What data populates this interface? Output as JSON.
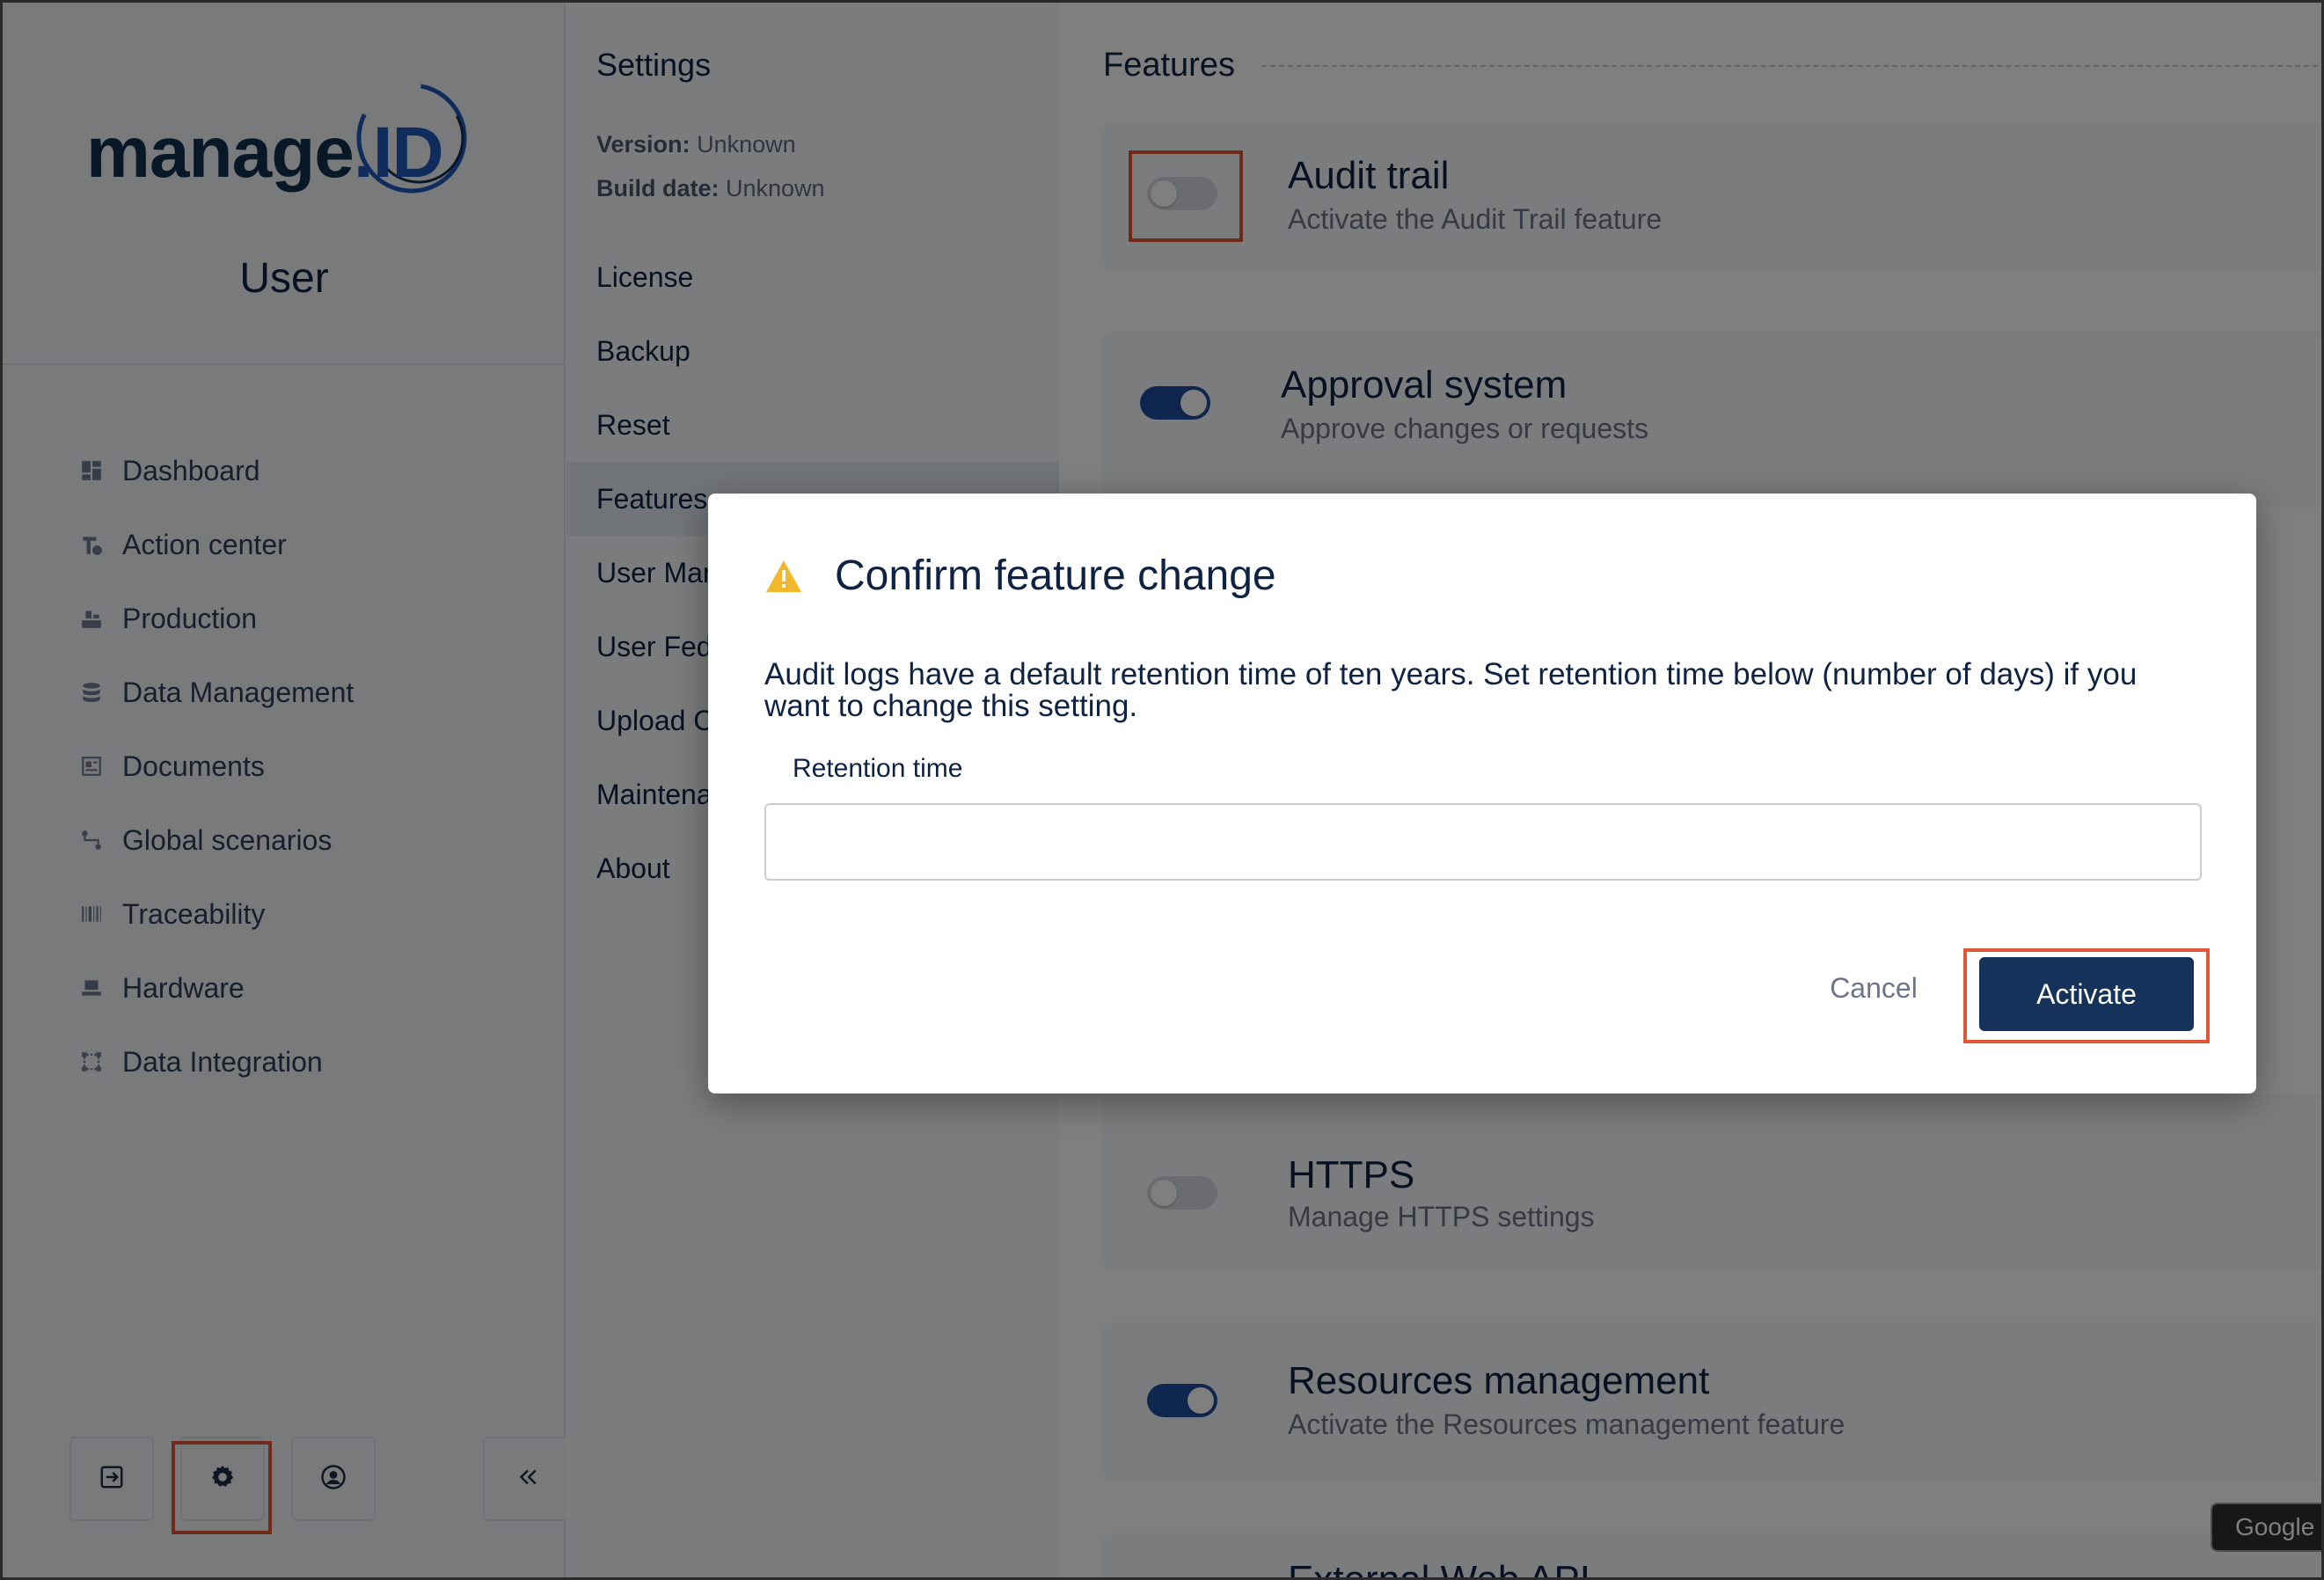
{
  "brand": {
    "logo_main": "manage",
    "logo_dot": ".",
    "logo_id": "ID"
  },
  "sidebar": {
    "user_title": "User",
    "nav": [
      {
        "label": "Dashboard",
        "icon": "dashboard-icon"
      },
      {
        "label": "Action center",
        "icon": "action-center-icon"
      },
      {
        "label": "Production",
        "icon": "production-icon"
      },
      {
        "label": "Data Management",
        "icon": "database-icon"
      },
      {
        "label": "Documents",
        "icon": "documents-icon"
      },
      {
        "label": "Global scenarios",
        "icon": "scenarios-icon"
      },
      {
        "label": "Traceability",
        "icon": "barcode-icon"
      },
      {
        "label": "Hardware",
        "icon": "hardware-icon"
      },
      {
        "label": "Data Integration",
        "icon": "integration-icon"
      }
    ],
    "bottom_buttons": [
      "logout-icon",
      "gear-icon",
      "account-icon",
      "collapse-icon"
    ]
  },
  "settings": {
    "title": "Settings",
    "version_label": "Version:",
    "version_value": "Unknown",
    "build_label": "Build date:",
    "build_value": "Unknown",
    "menu": [
      {
        "label": "License",
        "active": false
      },
      {
        "label": "Backup",
        "active": false
      },
      {
        "label": "Reset",
        "active": false
      },
      {
        "label": "Features",
        "active": true
      },
      {
        "label": "User Management",
        "active": false
      },
      {
        "label": "User Federation",
        "active": false
      },
      {
        "label": "Upload Certificates",
        "active": false
      },
      {
        "label": "Maintenance",
        "active": false
      },
      {
        "label": "About",
        "active": false
      }
    ]
  },
  "features": {
    "title": "Features",
    "items": [
      {
        "title": "Audit trail",
        "desc": "Activate the Audit Trail feature",
        "enabled": false
      },
      {
        "title": "Approval system",
        "desc": "Approve changes or requests",
        "enabled": true
      },
      {
        "title": "HTTPS",
        "desc": "Manage HTTPS settings",
        "enabled": false
      },
      {
        "title": "Resources management",
        "desc": "Activate the Resources management feature",
        "enabled": true
      },
      {
        "title": "External Web API",
        "desc": "",
        "enabled": false
      }
    ]
  },
  "tooltip": {
    "text": "Google Chrome"
  },
  "modal": {
    "title": "Confirm feature change",
    "text": "Audit logs have a default retention time of ten years. Set retention time below (number of days) if you want to change this setting.",
    "field_label": "Retention time",
    "field_value": "",
    "cancel_label": "Cancel",
    "activate_label": "Activate"
  },
  "colors": {
    "accent": "#15335a",
    "toggle_on": "#1f4f9e",
    "highlight": "#e25535",
    "warning": "#f1b82e"
  }
}
